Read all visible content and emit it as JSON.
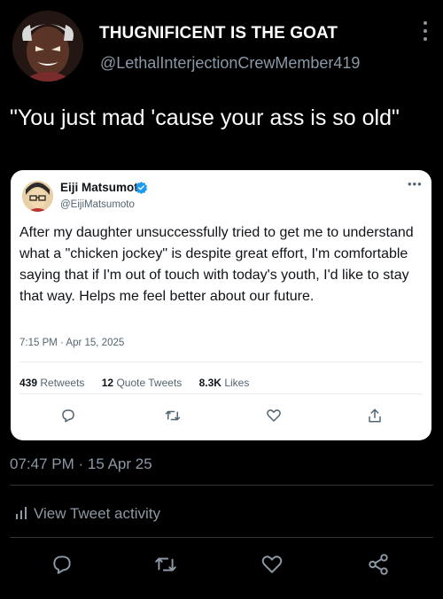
{
  "post": {
    "display_name": "THUGNIFICENT IS THE GOAT",
    "handle": "@LethalInterjectionCrewMember419",
    "text": "\"You just mad 'cause your ass is so old\"",
    "timestamp": "07:47 PM · 15 Apr 25"
  },
  "quoted": {
    "name": "Eiji Matsumoto",
    "handle": "@EijiMatsumoto",
    "text": "After my daughter unsuccessfully tried to get me to understand what a \"chicken jockey\" is despite great effort, I'm comfortable saying that if I'm out of touch with today's youth, I'd like to stay that way. Helps me feel better about our future.",
    "time": "7:15 PM · Apr 15, 2025",
    "stats": {
      "retweets_count": "439",
      "retweets_label": "Retweets",
      "quotes_count": "12",
      "quotes_label": "Quote Tweets",
      "likes_count": "8.3K",
      "likes_label": "Likes"
    }
  },
  "activity_label": "View Tweet activity",
  "icons": {
    "reply": "reply-icon",
    "retweet": "retweet-icon",
    "like": "like-icon",
    "share": "share-icon",
    "verified": "verified-badge-icon",
    "more": "more-icon"
  },
  "colors": {
    "background": "#000000",
    "secondary_text": "#8b98a5",
    "card_background": "#ffffff",
    "verified_blue": "#1d9bf0"
  }
}
